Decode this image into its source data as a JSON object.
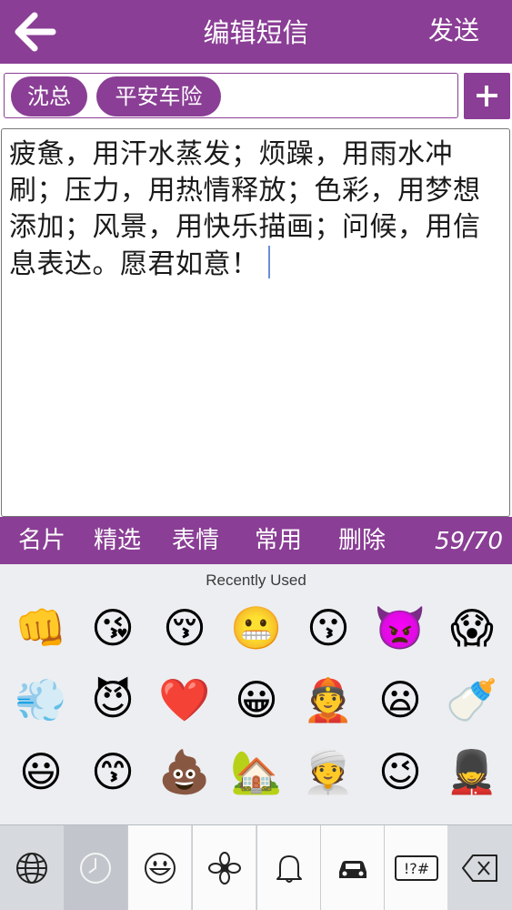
{
  "header": {
    "title": "编辑短信",
    "send_label": "发送",
    "bar_color": "#8a3e95"
  },
  "recipients": [
    {
      "name": "沈总"
    },
    {
      "name": "平安车险"
    }
  ],
  "message": {
    "text": "疲惫，用汗水蒸发；烦躁，用雨水冲刷；压力，用热情释放；色彩，用梦想添加；风景，用快乐描画；问候，用信息表达。愿君如意！"
  },
  "toolbar": {
    "items": [
      {
        "label": "名片"
      },
      {
        "label": "精选"
      },
      {
        "label": "表情"
      },
      {
        "label": "常用"
      },
      {
        "label": "删除"
      }
    ],
    "counter": "59/70"
  },
  "emoji_keyboard": {
    "section_label": "Recently Used",
    "emojis": [
      "👊",
      "😘",
      "😚",
      "😬",
      "😗",
      "👿",
      "😱",
      "💨",
      "😈",
      "❤️",
      "😀",
      "👲",
      "😦",
      "🍼",
      "😃",
      "😙",
      "💩",
      "🏡",
      "👳",
      "😉",
      "💂"
    ],
    "categories": [
      {
        "icon": "globe-icon",
        "selected": false
      },
      {
        "icon": "clock-icon",
        "selected": true
      },
      {
        "icon": "smiley-icon",
        "selected": false
      },
      {
        "icon": "flower-icon",
        "selected": false
      },
      {
        "icon": "bell-icon",
        "selected": false
      },
      {
        "icon": "car-icon",
        "selected": false
      },
      {
        "icon": "symbols-icon",
        "label": "!?#",
        "selected": false
      },
      {
        "icon": "backspace-icon",
        "selected": false
      }
    ]
  }
}
